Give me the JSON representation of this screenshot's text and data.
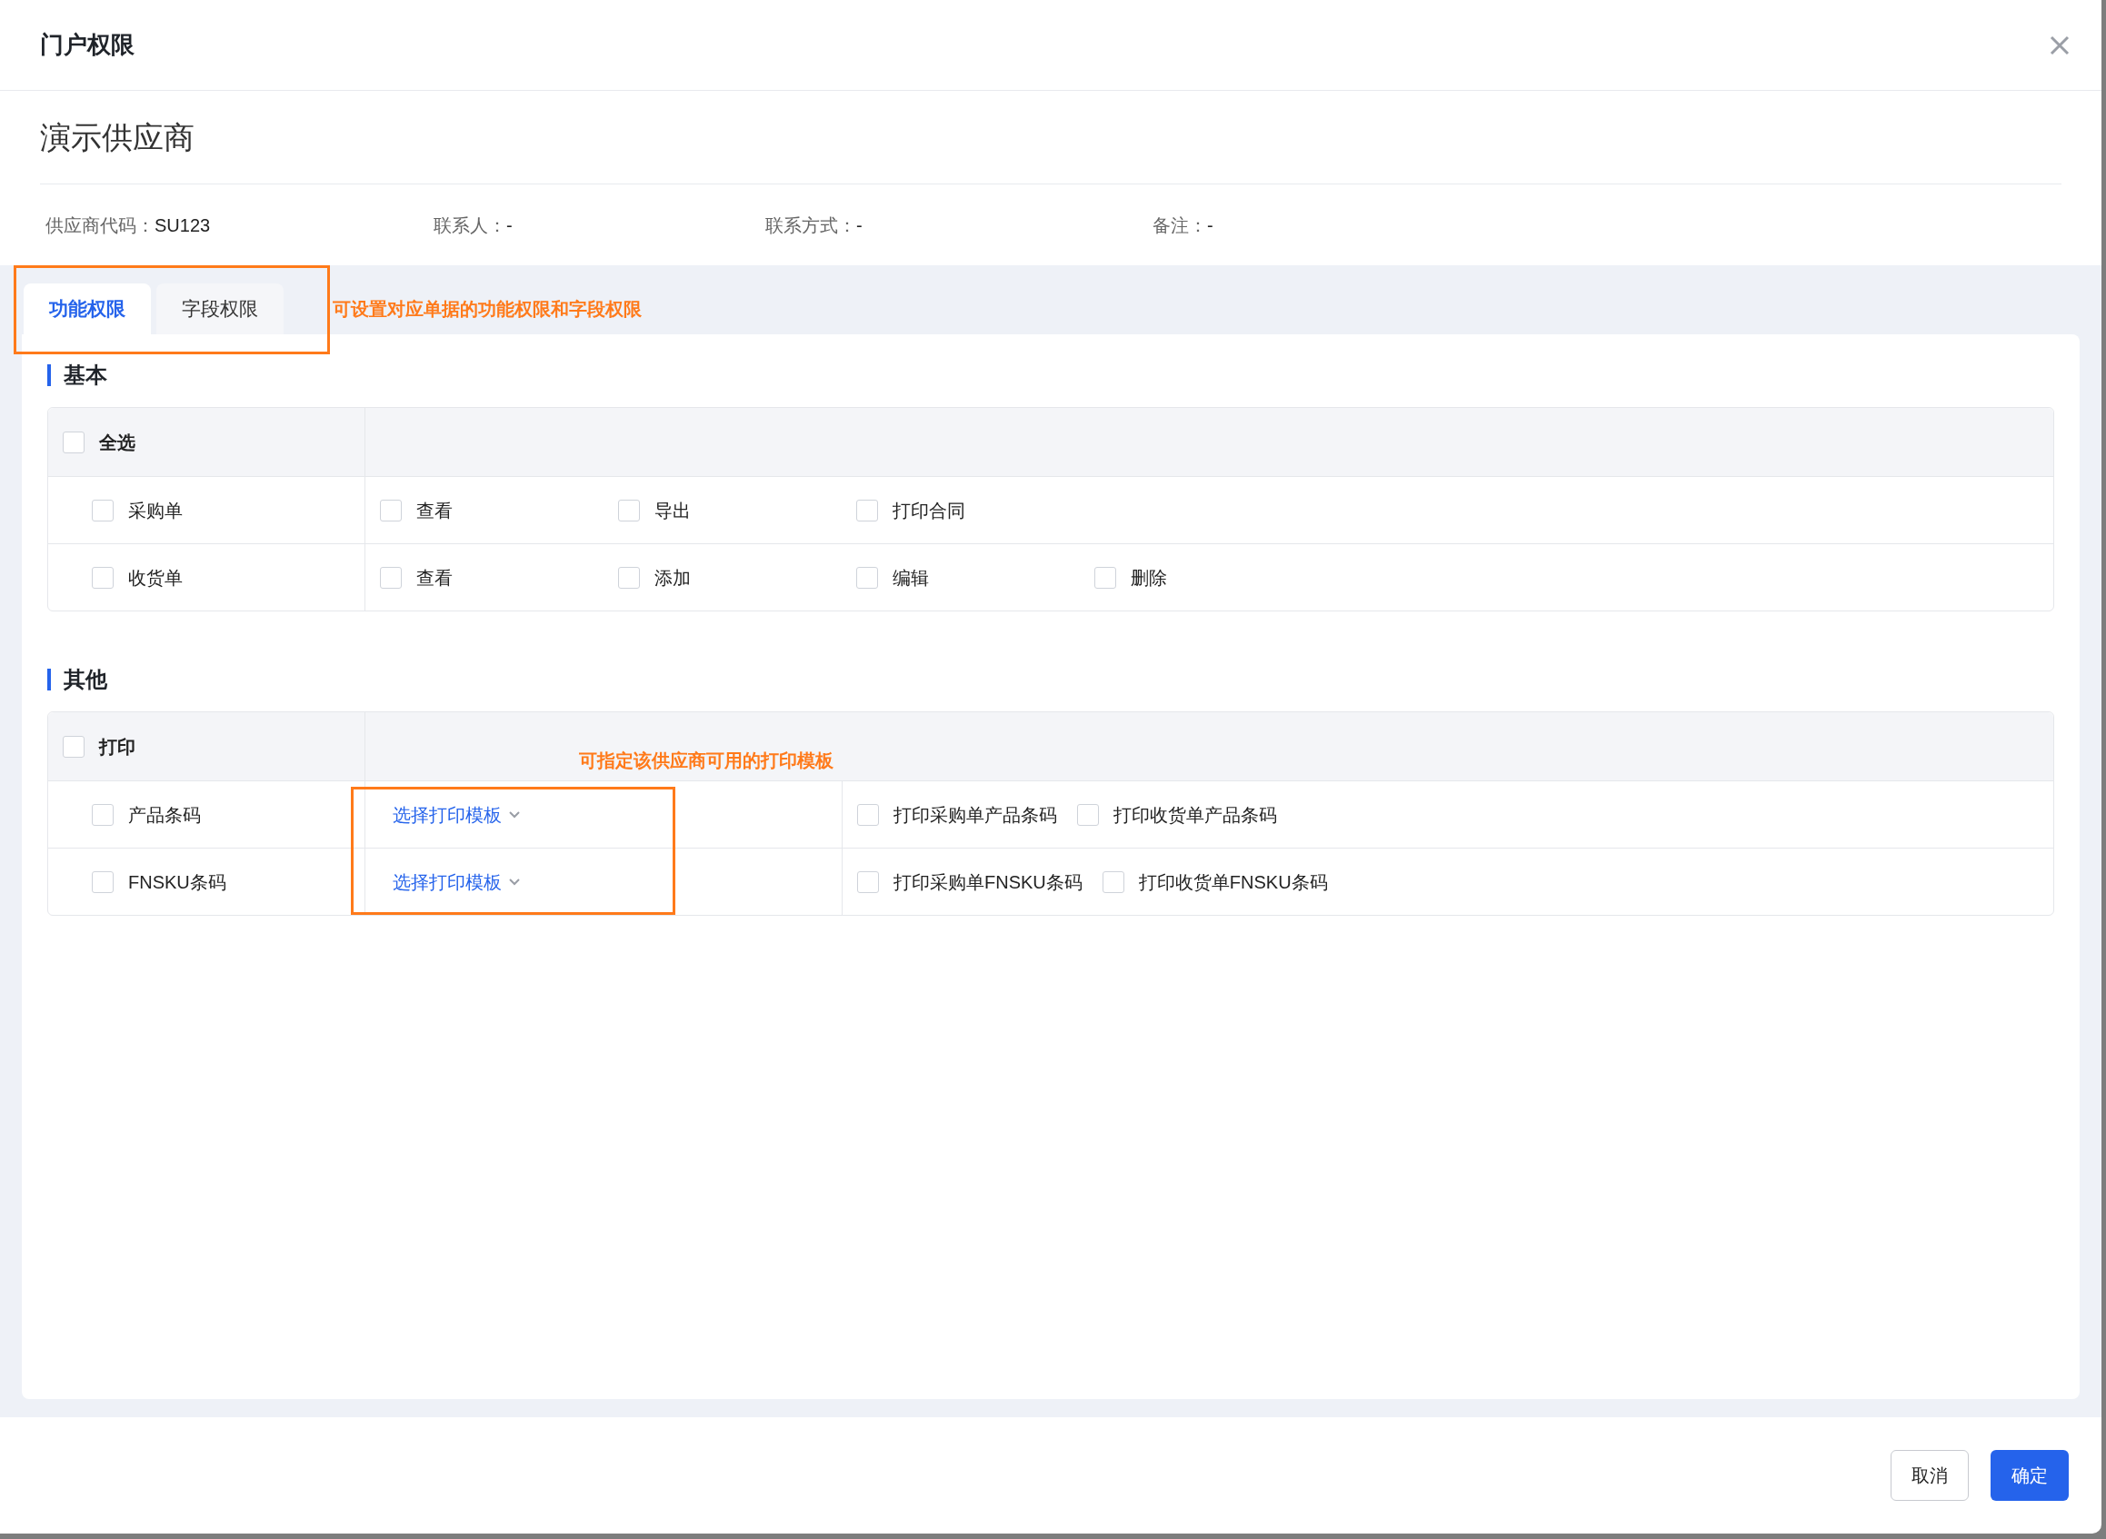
{
  "dialog": {
    "title": "门户权限"
  },
  "supplier": {
    "name": "演示供应商",
    "fields": [
      {
        "label": "供应商代码：",
        "value": "SU123"
      },
      {
        "label": "联系人：",
        "value": "-"
      },
      {
        "label": "联系方式：",
        "value": "-"
      },
      {
        "label": "备注：",
        "value": "-"
      }
    ]
  },
  "tabs": [
    {
      "label": "功能权限",
      "selected": true
    },
    {
      "label": "字段权限",
      "selected": false
    }
  ],
  "tabs_annotation": "可设置对应单据的功能权限和字段权限",
  "sections": [
    {
      "title": "基本",
      "group": {
        "label": "全选",
        "checked": false
      },
      "rows": [
        {
          "label": "采购单",
          "checked": false,
          "permissions": [
            {
              "label": "查看",
              "checked": false
            },
            {
              "label": "导出",
              "checked": false
            },
            {
              "label": "打印合同",
              "checked": false
            }
          ]
        },
        {
          "label": "收货单",
          "checked": false,
          "permissions": [
            {
              "label": "查看",
              "checked": false
            },
            {
              "label": "添加",
              "checked": false
            },
            {
              "label": "编辑",
              "checked": false
            },
            {
              "label": "删除",
              "checked": false
            }
          ]
        }
      ]
    },
    {
      "title": "其他",
      "group": {
        "label": "打印",
        "checked": false
      },
      "annotation": "可指定该供应商可用的打印模板",
      "rows": [
        {
          "label": "产品条码",
          "checked": false,
          "template": "选择打印模板",
          "permissions": [
            {
              "label": "打印采购单产品条码",
              "checked": false
            },
            {
              "label": "打印收货单产品条码",
              "checked": false
            }
          ]
        },
        {
          "label": "FNSKU条码",
          "checked": false,
          "template": "选择打印模板",
          "permissions": [
            {
              "label": "打印采购单FNSKU条码",
              "checked": false
            },
            {
              "label": "打印收货单FNSKU条码",
              "checked": false
            }
          ]
        }
      ]
    }
  ],
  "buttons": [
    {
      "label": "取消",
      "kind": "secondary"
    },
    {
      "label": "确定",
      "kind": "primary"
    }
  ]
}
